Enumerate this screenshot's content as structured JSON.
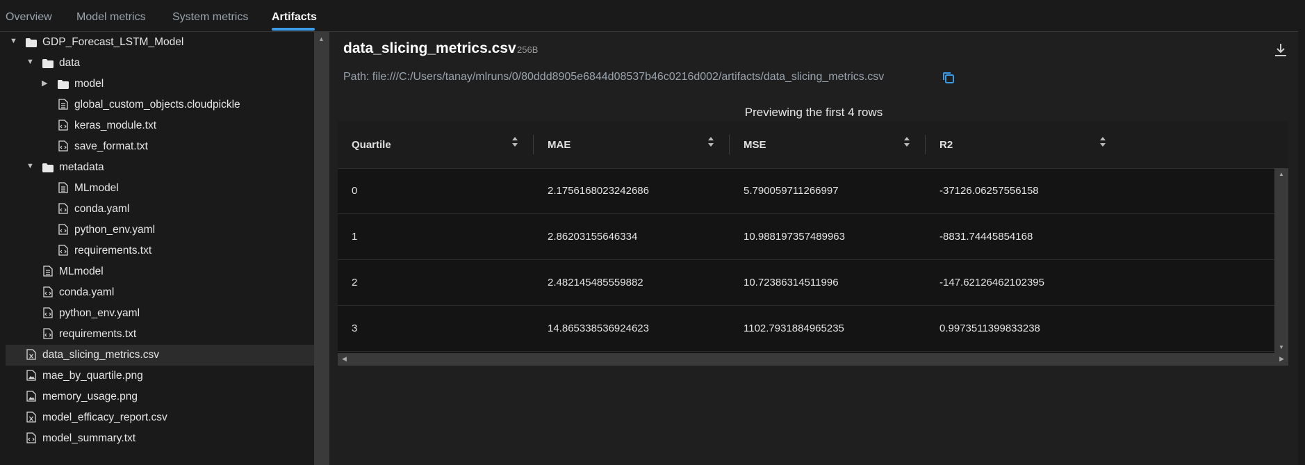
{
  "tabs": [
    "Overview",
    "Model metrics",
    "System metrics",
    "Artifacts"
  ],
  "active_tab": "Artifacts",
  "tree": [
    {
      "label": "GDP_Forecast_LSTM_Model",
      "type": "folder",
      "expanded": true,
      "depth": 0
    },
    {
      "label": "data",
      "type": "folder",
      "expanded": true,
      "depth": 1
    },
    {
      "label": "model",
      "type": "folder",
      "expanded": false,
      "depth": 2
    },
    {
      "label": "global_custom_objects.cloudpickle",
      "type": "doc",
      "depth": 2
    },
    {
      "label": "keras_module.txt",
      "type": "code",
      "depth": 2
    },
    {
      "label": "save_format.txt",
      "type": "code",
      "depth": 2
    },
    {
      "label": "metadata",
      "type": "folder",
      "expanded": true,
      "depth": 1
    },
    {
      "label": "MLmodel",
      "type": "doc",
      "depth": 2
    },
    {
      "label": "conda.yaml",
      "type": "code",
      "depth": 2
    },
    {
      "label": "python_env.yaml",
      "type": "code",
      "depth": 2
    },
    {
      "label": "requirements.txt",
      "type": "code",
      "depth": 2
    },
    {
      "label": "MLmodel",
      "type": "doc",
      "depth": 1
    },
    {
      "label": "conda.yaml",
      "type": "code",
      "depth": 1
    },
    {
      "label": "python_env.yaml",
      "type": "code",
      "depth": 1
    },
    {
      "label": "requirements.txt",
      "type": "code",
      "depth": 1
    },
    {
      "label": "data_slicing_metrics.csv",
      "type": "sheet",
      "depth": 0,
      "selected": true
    },
    {
      "label": "mae_by_quartile.png",
      "type": "image",
      "depth": 0
    },
    {
      "label": "memory_usage.png",
      "type": "image",
      "depth": 0
    },
    {
      "label": "model_efficacy_report.csv",
      "type": "sheet",
      "depth": 0
    },
    {
      "label": "model_summary.txt",
      "type": "code",
      "depth": 0
    }
  ],
  "file": {
    "name": "data_slicing_metrics.csv",
    "size": "256B",
    "path": "Path: file:///C:/Users/tanay/mlruns/0/80ddd8905e6844d08537b46c0216d002/artifacts/data_slicing_metrics.csv"
  },
  "preview_label": "Previewing the first 4 rows",
  "table": {
    "columns": [
      "Quartile",
      "MAE",
      "MSE",
      "R2"
    ],
    "rows": [
      [
        "0",
        "2.1756168023242686",
        "5.790059711266997",
        "-37126.06257556158"
      ],
      [
        "1",
        "2.86203155646334",
        "10.988197357489963",
        "-8831.74445854168"
      ],
      [
        "2",
        "2.482145485559882",
        "10.72386314511996",
        "-147.62126462102395"
      ],
      [
        "3",
        "14.865338536924623",
        "1102.7931884965235",
        "0.9973511399833238"
      ]
    ]
  },
  "colors": {
    "accent": "#3b9be6",
    "selected_row": "#2c2c2c"
  },
  "icons": {
    "download": "download-icon",
    "copy": "copy-icon",
    "sort": "sort-icon"
  }
}
